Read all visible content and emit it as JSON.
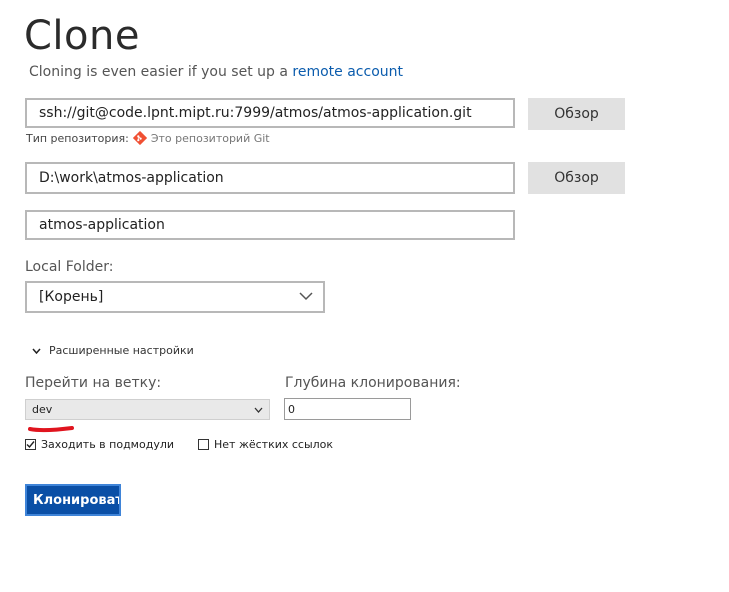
{
  "header": {
    "title": "Clone",
    "subtitle_prefix": "Cloning is even easier if you set up a",
    "subtitle_link": "remote account"
  },
  "source": {
    "url_value": "ssh://git@code.lpnt.mipt.ru:7999/atmos/atmos-application.git",
    "browse_label": "Обзор",
    "repo_type_label": "Тип репозитория:",
    "repo_type_value": "Это репозиторий Git"
  },
  "destination": {
    "path_value": "D:\\work\\atmos-application",
    "browse_label": "Обзор"
  },
  "name": {
    "value": "atmos-application"
  },
  "local_folder": {
    "label": "Local Folder:",
    "selected": "[Корень]"
  },
  "advanced": {
    "toggle_label": "Расширенные настройки",
    "branch_label": "Перейти на ветку:",
    "branch_selected": "dev",
    "depth_label": "Глубина клонирования:",
    "depth_value": "0",
    "recurse_label": "Заходить в подмодули",
    "recurse_checked": true,
    "no_hardlinks_label": "Нет жёстких ссылок",
    "no_hardlinks_checked": false
  },
  "actions": {
    "clone_label": "Клонировать"
  },
  "colors": {
    "link": "#0b5cad",
    "primary_button": "#0a4fa6",
    "git_icon": "#f05033",
    "annotation_underline": "#e0141e"
  }
}
